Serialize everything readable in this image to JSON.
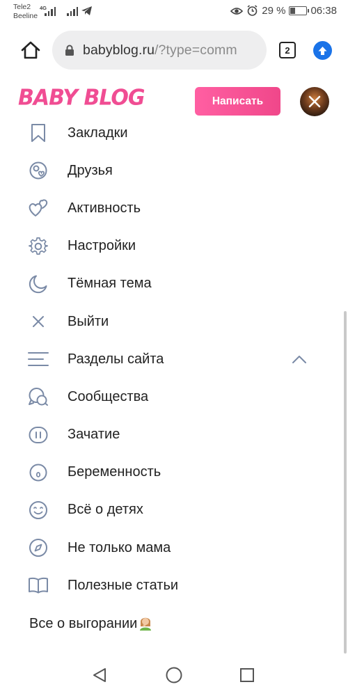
{
  "status_bar": {
    "carrier_1": "Tele2",
    "carrier_2": "Beeline",
    "network_1": "4G",
    "battery_percent": "29 %",
    "battery_level": 0.29,
    "time": "06:38"
  },
  "browser": {
    "url_domain": "babyblog.ru",
    "url_path": "/?type=comm",
    "tab_count": "2"
  },
  "header": {
    "logo_text": "BABY BLOG",
    "write_button": "Написать"
  },
  "menu": {
    "items": [
      {
        "label": "Закладки",
        "icon": "bookmark-icon"
      },
      {
        "label": "Друзья",
        "icon": "friends-icon"
      },
      {
        "label": "Активность",
        "icon": "hearts-icon"
      },
      {
        "label": "Настройки",
        "icon": "gear-icon"
      },
      {
        "label": "Тёмная тема",
        "icon": "moon-icon"
      },
      {
        "label": "Выйти",
        "icon": "close-icon"
      },
      {
        "label": "Разделы сайта",
        "icon": "menu-lines-icon"
      },
      {
        "label": "Сообщества",
        "icon": "chat-bubbles-icon"
      },
      {
        "label": "Зачатие",
        "icon": "pause-circle-icon"
      },
      {
        "label": "Беременность",
        "icon": "egg-icon"
      },
      {
        "label": "Всё о детях",
        "icon": "smile-icon"
      },
      {
        "label": "Не только мама",
        "icon": "compass-icon"
      },
      {
        "label": "Полезные статьи",
        "icon": "book-icon"
      },
      {
        "label": "Все о выгорании",
        "icon": "woman-facepalm-emoji"
      }
    ]
  },
  "colors": {
    "brand_pink": "#f04d93",
    "icon_gray": "#7a8aa6",
    "chrome_blue": "#1a73e8"
  }
}
